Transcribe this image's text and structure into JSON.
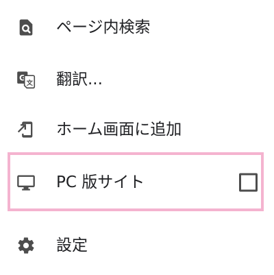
{
  "menu": {
    "items": [
      {
        "label": "ページ内検索",
        "icon": "find-in-page-icon"
      },
      {
        "label": "翻訳...",
        "icon": "translate-icon"
      },
      {
        "label": "ホーム画面に追加",
        "icon": "add-to-home-screen-icon"
      },
      {
        "label": "PC 版サイト",
        "icon": "desktop-icon",
        "checked": false
      },
      {
        "label": "設定",
        "icon": "gear-icon"
      }
    ]
  },
  "colors": {
    "icon": "#4d4d4d",
    "text": "#202124",
    "highlight_border": "#f4b3cf",
    "background": "#ffffff"
  }
}
